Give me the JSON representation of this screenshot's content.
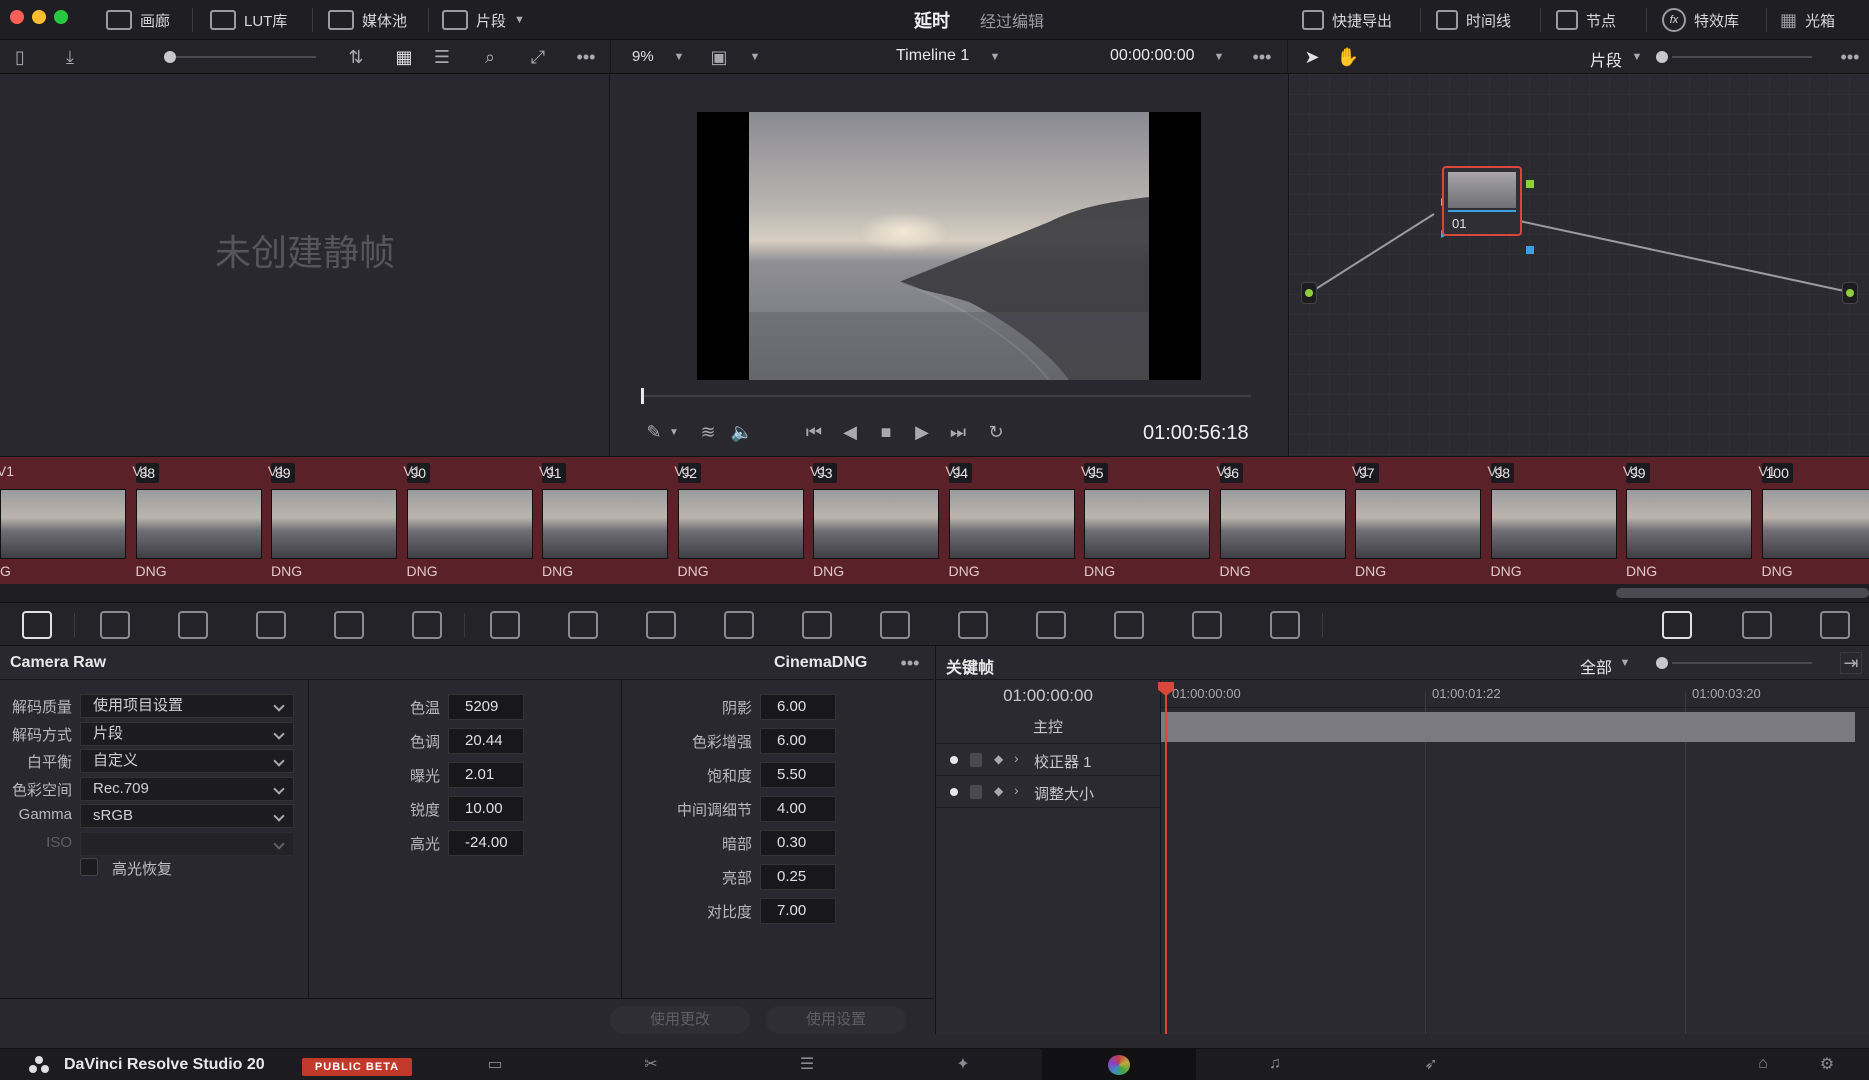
{
  "topbar": {
    "items": [
      {
        "label": "画廊"
      },
      {
        "label": "LUT库"
      },
      {
        "label": "媒体池"
      },
      {
        "label": "片段"
      }
    ],
    "title": "延时",
    "subtitle": "经过编辑",
    "right_items": [
      {
        "label": "快捷导出"
      },
      {
        "label": "时间线"
      },
      {
        "label": "节点"
      },
      {
        "label": "特效库"
      },
      {
        "label": "光箱"
      }
    ]
  },
  "viewer": {
    "zoom": "9%",
    "timeline_name": "Timeline 1",
    "timecode_top": "00:00:00:00",
    "playhead_timecode": "01:00:56:18"
  },
  "gallery": {
    "empty_text": "未创建静帧"
  },
  "nodes": {
    "mode_label": "片段",
    "node_label": "01"
  },
  "clips": [
    {
      "num": "",
      "track": "V1",
      "type": "G"
    },
    {
      "num": "88",
      "track": "V1",
      "type": "DNG"
    },
    {
      "num": "89",
      "track": "V1",
      "type": "DNG"
    },
    {
      "num": "90",
      "track": "V1",
      "type": "DNG"
    },
    {
      "num": "91",
      "track": "V1",
      "type": "DNG"
    },
    {
      "num": "92",
      "track": "V1",
      "type": "DNG"
    },
    {
      "num": "93",
      "track": "V1",
      "type": "DNG"
    },
    {
      "num": "94",
      "track": "V1",
      "type": "DNG"
    },
    {
      "num": "95",
      "track": "V1",
      "type": "DNG"
    },
    {
      "num": "96",
      "track": "V1",
      "type": "DNG"
    },
    {
      "num": "97",
      "track": "V1",
      "type": "DNG"
    },
    {
      "num": "98",
      "track": "V1",
      "type": "DNG"
    },
    {
      "num": "99",
      "track": "V1",
      "type": "DNG"
    },
    {
      "num": "100",
      "track": "V1",
      "type": "DNG"
    }
  ],
  "camera_raw": {
    "title": "Camera Raw",
    "format": "CinemaDNG",
    "left_fields": [
      {
        "label": "解码质量",
        "value": "使用项目设置"
      },
      {
        "label": "解码方式",
        "value": "片段"
      },
      {
        "label": "白平衡",
        "value": "自定义"
      },
      {
        "label": "色彩空间",
        "value": "Rec.709"
      },
      {
        "label": "Gamma",
        "value": "sRGB"
      },
      {
        "label": "ISO",
        "value": ""
      }
    ],
    "highlight_recovery": "高光恢复",
    "mid_fields": [
      {
        "label": "色温",
        "value": "5209"
      },
      {
        "label": "色调",
        "value": "20.44"
      },
      {
        "label": "曝光",
        "value": "2.01"
      },
      {
        "label": "锐度",
        "value": "10.00"
      },
      {
        "label": "高光",
        "value": "-24.00"
      }
    ],
    "right_fields": [
      {
        "label": "阴影",
        "value": "6.00"
      },
      {
        "label": "色彩增强",
        "value": "6.00"
      },
      {
        "label": "饱和度",
        "value": "5.50"
      },
      {
        "label": "中间调细节",
        "value": "4.00"
      },
      {
        "label": "暗部",
        "value": "0.30"
      },
      {
        "label": "亮部",
        "value": "0.25"
      },
      {
        "label": "对比度",
        "value": "7.00"
      }
    ],
    "use_changes": "使用更改",
    "use_settings": "使用设置"
  },
  "keyframes": {
    "title": "关键帧",
    "filter": "全部",
    "timecode": "01:00:00:00",
    "ruler": [
      "01:00:00:00",
      "01:00:01:22",
      "01:00:03:20"
    ],
    "rows": [
      {
        "label": "主控"
      },
      {
        "label": "校正器 1"
      },
      {
        "label": "调整大小"
      }
    ]
  },
  "footer": {
    "app_name": "DaVinci Resolve Studio 20",
    "badge": "PUBLIC BETA"
  },
  "colors": {
    "accent_red": "#d9463a",
    "clip_strip": "#5a2228",
    "badge_bg": "#c0392b"
  }
}
